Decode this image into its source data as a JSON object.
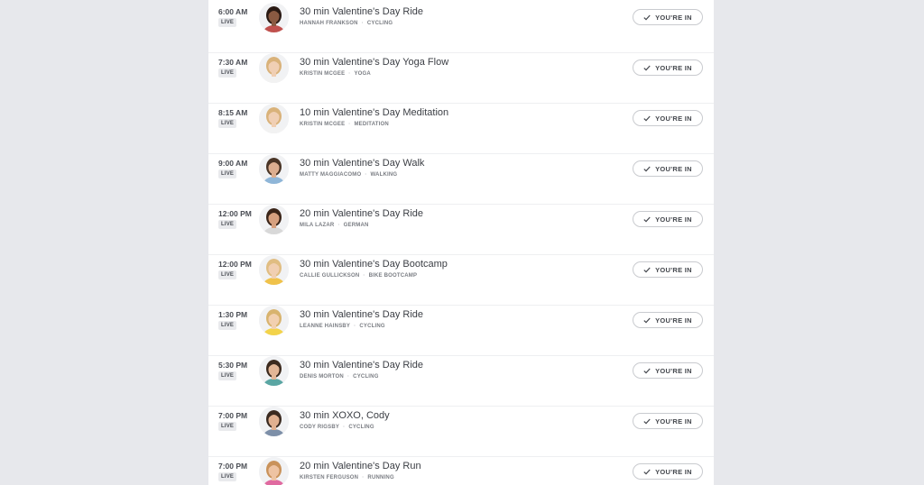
{
  "classes": [
    {
      "time": "6:00 AM",
      "live": "LIVE",
      "title": "30 min Valentine's Day Ride",
      "instructor": "HANNAH FRANKSON",
      "category": "CYCLING",
      "button": "YOU'RE IN"
    },
    {
      "time": "7:30 AM",
      "live": "LIVE",
      "title": "30 min Valentine's Day Yoga Flow",
      "instructor": "KRISTIN MCGEE",
      "category": "YOGA",
      "button": "YOU'RE IN"
    },
    {
      "time": "8:15 AM",
      "live": "LIVE",
      "title": "10 min Valentine's Day Meditation",
      "instructor": "KRISTIN MCGEE",
      "category": "MEDITATION",
      "button": "YOU'RE IN"
    },
    {
      "time": "9:00 AM",
      "live": "LIVE",
      "title": "30 min Valentine's Day Walk",
      "instructor": "MATTY MAGGIACOMO",
      "category": "WALKING",
      "button": "YOU'RE IN"
    },
    {
      "time": "12:00 PM",
      "live": "LIVE",
      "title": "20 min Valentine's Day Ride",
      "instructor": "MILA LAZAR",
      "category": "GERMAN",
      "button": "YOU'RE IN"
    },
    {
      "time": "12:00 PM",
      "live": "LIVE",
      "title": "30 min Valentine's Day Bootcamp",
      "instructor": "CALLIE GULLICKSON",
      "category": "BIKE BOOTCAMP",
      "button": "YOU'RE IN"
    },
    {
      "time": "1:30 PM",
      "live": "LIVE",
      "title": "30 min Valentine's Day Ride",
      "instructor": "LEANNE HAINSBY",
      "category": "CYCLING",
      "button": "YOU'RE IN"
    },
    {
      "time": "5:30 PM",
      "live": "LIVE",
      "title": "30 min Valentine's Day Ride",
      "instructor": "DENIS MORTON",
      "category": "CYCLING",
      "button": "YOU'RE IN"
    },
    {
      "time": "7:00 PM",
      "live": "LIVE",
      "title": "30 min XOXO, Cody",
      "instructor": "CODY RIGSBY",
      "category": "CYCLING",
      "button": "YOU'RE IN"
    },
    {
      "time": "7:00 PM",
      "live": "LIVE",
      "title": "20 min Valentine's Day Run",
      "instructor": "KIRSTEN FERGUSON",
      "category": "RUNNING",
      "button": "YOU'RE IN"
    }
  ],
  "avatar_colors": [
    {
      "hair": "#2a1a14",
      "skin": "#8a5a42",
      "shirt": "#c0504d"
    },
    {
      "hair": "#d9b27a",
      "skin": "#f0cfb4",
      "shirt": "#f2f2f2"
    },
    {
      "hair": "#d9b27a",
      "skin": "#f0cfb4",
      "shirt": "#f2f2f2"
    },
    {
      "hair": "#4a3526",
      "skin": "#dcae90",
      "shirt": "#8fb6d8"
    },
    {
      "hair": "#3a2418",
      "skin": "#d6a07f",
      "shirt": "#d8d8d8"
    },
    {
      "hair": "#e0bd82",
      "skin": "#f1cfb2",
      "shirt": "#f0c24a"
    },
    {
      "hair": "#d8b36e",
      "skin": "#f2d0b0",
      "shirt": "#f3d34a"
    },
    {
      "hair": "#3c2a1e",
      "skin": "#e3b696",
      "shirt": "#5aa6a3"
    },
    {
      "hair": "#3a2a20",
      "skin": "#e0b090",
      "shirt": "#7d8fa8"
    },
    {
      "hair": "#c9925a",
      "skin": "#eec3a2",
      "shirt": "#e06aa0"
    }
  ],
  "icons": {
    "check": "check-icon"
  }
}
